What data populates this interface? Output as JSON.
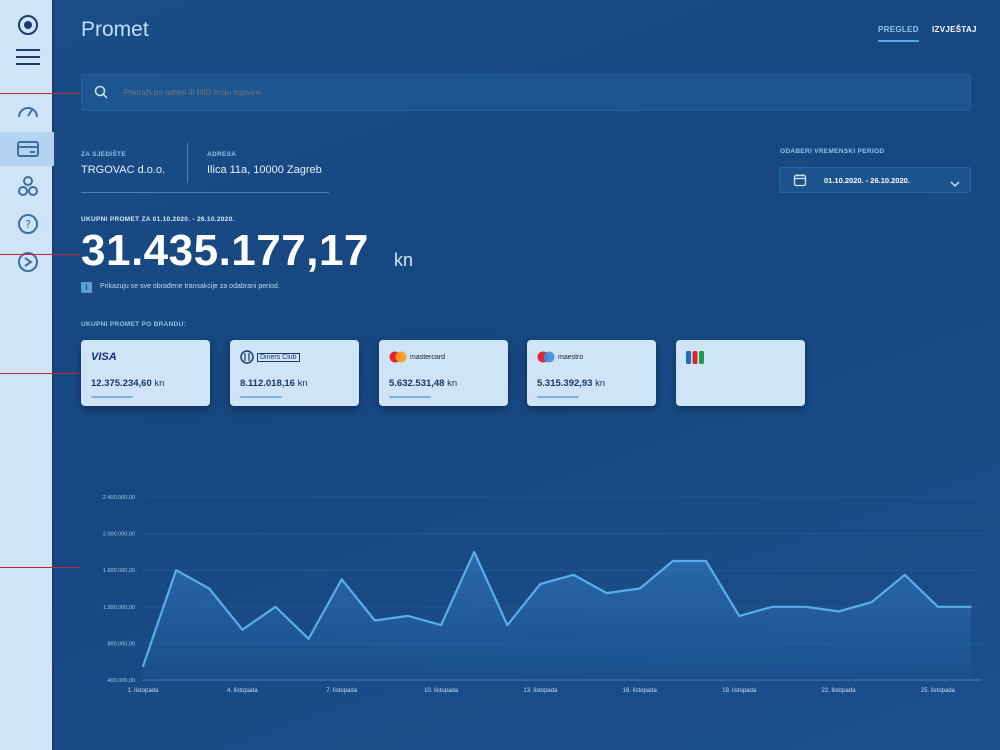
{
  "page": {
    "title": "Promet",
    "tabs": [
      {
        "label": "PREGLED",
        "active": true
      },
      {
        "label": "IZVJEŠTAJ",
        "active": false
      }
    ]
  },
  "search": {
    "placeholder": "Pretraži po adresi ili MID broju trgovine"
  },
  "merchant": {
    "label": "ZA SJEDIŠTE",
    "value": "TRGOVAC d.o.o."
  },
  "address": {
    "label": "ADRESA",
    "value": "Ilica 11a, 10000 Zagreb"
  },
  "period": {
    "label": "ODABERI VREMENSKI PERIOD",
    "value": "01.10.2020. - 26.10.2020."
  },
  "total": {
    "label": "UKUPNI PROMET ZA 01.10.2020. - 26.10.2020.",
    "amount": "31.435.177,17",
    "currency": "kn",
    "info_icon": "i",
    "info": "Prikazuju se sve obrađene transakcije za odabrani period."
  },
  "brands": {
    "label": "UKUPNI PROMET PO BRANDU:",
    "currency": "kn",
    "items": [
      {
        "brand": "VISA",
        "amount": "12.375.234,60"
      },
      {
        "brand": "Diners Club",
        "amount": "8.112.018,16"
      },
      {
        "brand": "mastercard",
        "amount": "5.632.531,48"
      },
      {
        "brand": "maestro",
        "amount": "5.315.392,93"
      },
      {
        "brand": "JCB",
        "amount": ""
      }
    ]
  },
  "colors": {
    "background": "#174781",
    "accent": "#5aa8e4",
    "card": "#cfe4f7",
    "chart_line": "#5aaee8",
    "guide": "#c0283a"
  },
  "icons": [
    "logo-icon",
    "menu-icon",
    "dashboard-icon",
    "card-icon",
    "users-icon",
    "help-icon",
    "logout-icon",
    "search-icon",
    "calendar-icon",
    "chevron-down-icon",
    "info-icon"
  ],
  "chart_data": {
    "type": "area",
    "title": "",
    "xlabel": "",
    "ylabel": "",
    "ylim": [
      400000,
      2400000
    ],
    "y_ticks": [
      "2.400.000,00",
      "2.000.000,00",
      "1.600.000,00",
      "1.200.000,00",
      "800.000,00",
      "400.000,00"
    ],
    "y_tick_values": [
      2400000,
      2000000,
      1600000,
      1200000,
      800000,
      400000
    ],
    "x_tick_labels": [
      "1. listopada",
      "4. listopada",
      "7. listopada",
      "10. listopada",
      "13. listopada",
      "16. listopada",
      "19. listopada",
      "22. listopada",
      "25. listopada"
    ],
    "x_tick_days": [
      1,
      4,
      7,
      10,
      13,
      16,
      19,
      22,
      25
    ],
    "x": [
      1,
      2,
      3,
      4,
      5,
      6,
      7,
      8,
      9,
      10,
      11,
      12,
      13,
      14,
      15,
      16,
      17,
      18,
      19,
      20,
      21,
      22,
      23,
      24,
      25,
      26
    ],
    "values": [
      550000,
      1600000,
      1400000,
      950000,
      1200000,
      850000,
      1500000,
      1050000,
      1100000,
      1000000,
      1800000,
      1000000,
      1450000,
      1550000,
      1350000,
      1400000,
      1700000,
      1700000,
      1100000,
      1200000,
      1200000,
      1150000,
      1250000,
      1550000,
      1200000,
      1200000
    ],
    "grid": true,
    "legend": "none"
  }
}
